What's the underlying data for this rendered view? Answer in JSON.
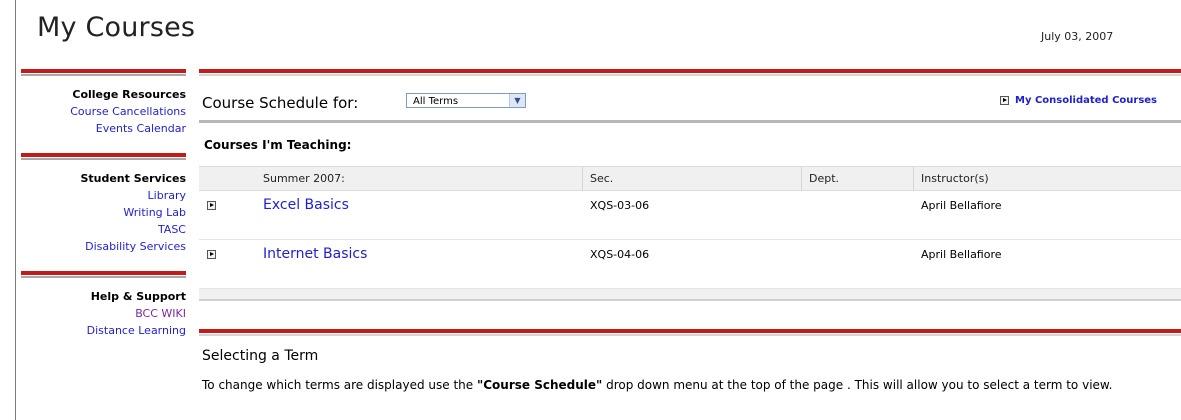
{
  "page": {
    "title": "My Courses",
    "date": "July 03, 2007"
  },
  "sidebar": {
    "sections": [
      {
        "heading": "College Resources",
        "links": [
          "Course Cancellations",
          "Events Calendar"
        ]
      },
      {
        "heading": "Student Services",
        "links": [
          "Library",
          "Writing Lab",
          "TASC",
          "Disability Services"
        ]
      },
      {
        "heading": "Help & Support",
        "links": [
          "BCC WIKI",
          "Distance Learning"
        ]
      }
    ]
  },
  "main": {
    "schedule_label": "Course Schedule for:",
    "term_select": {
      "value": "All Terms"
    },
    "consolidated_link": "My Consolidated Courses",
    "teaching_heading": "Courses I'm Teaching:",
    "table": {
      "headers": [
        "Summer 2007:",
        "Sec.",
        "Dept.",
        "Instructor(s)"
      ],
      "rows": [
        {
          "course": "Excel Basics",
          "sec": "XQS-03-06",
          "dept": "",
          "instructor": "April Bellafiore"
        },
        {
          "course": "Internet Basics",
          "sec": "XQS-04-06",
          "dept": "",
          "instructor": "April Bellafiore"
        }
      ]
    },
    "help": {
      "title": "Selecting a Term",
      "text_before": "To change which terms are displayed use the ",
      "text_bold": "\"Course Schedule\"",
      "text_after": " drop down menu at the top of the page . This will allow you to select a term to view."
    }
  },
  "colors": {
    "accent_red": "#c41a1a",
    "link_blue": "#1f1fd0",
    "visited_purple": "#7a2a9a"
  }
}
